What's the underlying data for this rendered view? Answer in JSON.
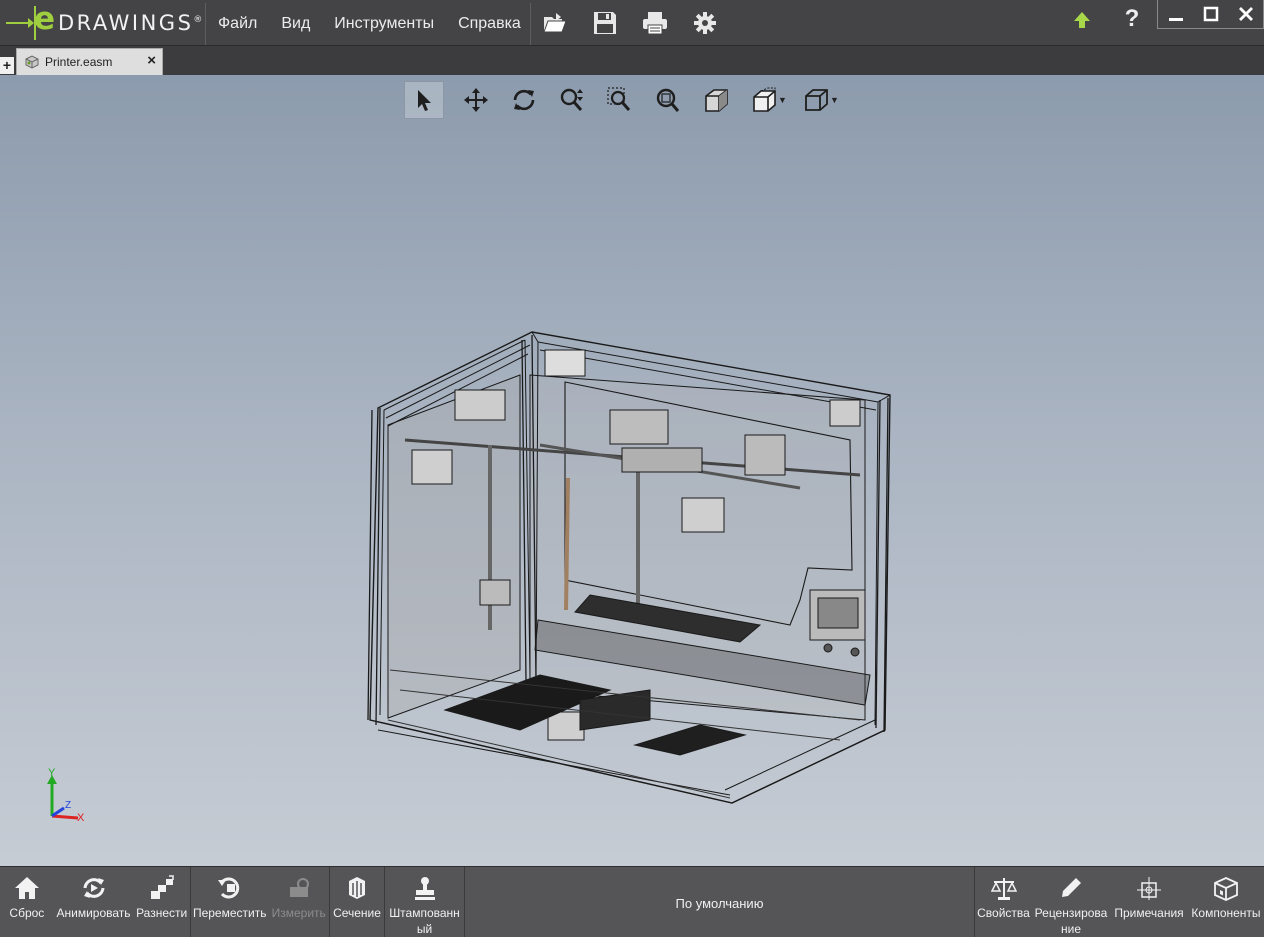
{
  "app": {
    "logo_e": "e",
    "logo_word": "DRAWINGS",
    "logo_reg": "®"
  },
  "menu": {
    "file": "Файл",
    "view": "Вид",
    "tools": "Инструменты",
    "help": "Справка"
  },
  "toolbar_icons": [
    "open-icon",
    "save-icon",
    "print-icon",
    "settings-icon"
  ],
  "titlebar_right": {
    "help": "?",
    "icons": [
      "upgrade-arrow-icon",
      "minimize-icon",
      "maximize-icon",
      "close-icon"
    ]
  },
  "tabs": {
    "add": "+",
    "document": "Printer.easm",
    "close": "×"
  },
  "view_toolbar": [
    "select-icon",
    "pan-icon",
    "rotate-icon",
    "zoom-icon",
    "zoom-to-area-icon",
    "zoom-to-fit-icon",
    "shaded-view-icon",
    "standard-views-icon",
    "display-style-icon"
  ],
  "triad": {
    "y": "Y",
    "z": "Z",
    "x": "X"
  },
  "bottom": {
    "reset": "Сброс",
    "animate": "Анимировать",
    "explode": "Разнести",
    "move": "Переместить",
    "measure": "Измерить",
    "section": "Сечение",
    "stamp": "Штампованный",
    "configuration": "По умолчанию",
    "properties": "Свойства",
    "review": "Рецензирование",
    "notes": "Примечания",
    "components": "Компоненты"
  },
  "colors": {
    "accent": "#9fcf3f",
    "titlebar": "#444446",
    "bottombar": "#555557"
  }
}
